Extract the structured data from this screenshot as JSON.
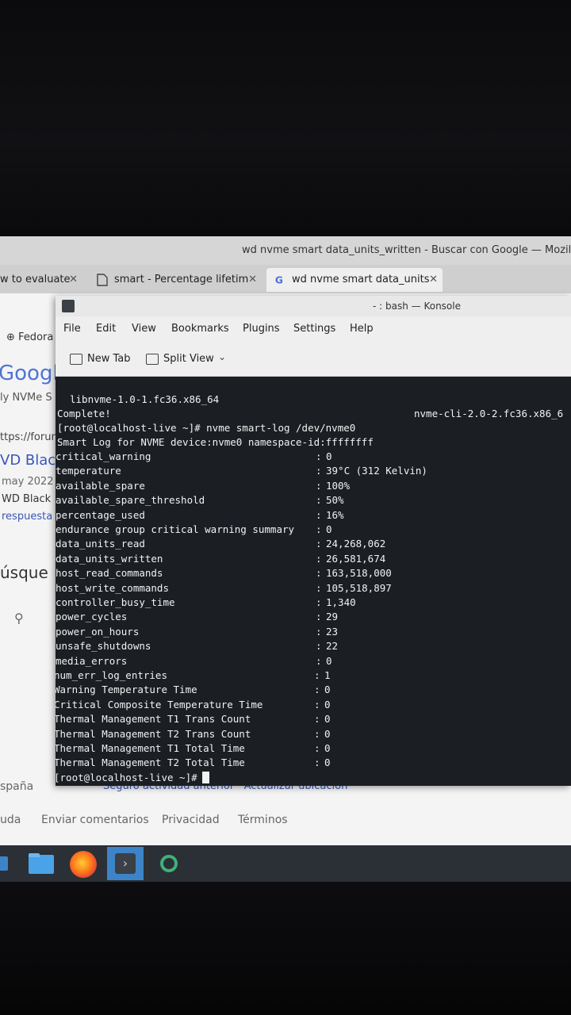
{
  "firefox": {
    "window_title": "wd nvme smart data_units_written - Buscar con Google — Mozilla Fire",
    "tabs": [
      {
        "label": "w to evaluate"
      },
      {
        "label": "smart - Percentage lifetim"
      },
      {
        "label": "wd nvme smart data_units"
      }
    ],
    "page_fragments": {
      "fedora": "Fedora",
      "google": "Google",
      "nvme": "ly NVMe S",
      "url": "ttps://forum",
      "wd_black": "VD Black",
      "date": "may 2022",
      "wd_black2": "WD Black",
      "respuesta": "respuesta",
      "busque": "úsque",
      "espana": "spaña",
      "location_line": "Seguro actividad anterior · Actualizar ubicación",
      "footer_links": [
        "uda",
        "Enviar comentarios",
        "Privacidad",
        "Términos"
      ]
    }
  },
  "konsole": {
    "title": "- : bash — Konsole",
    "menu": [
      "File",
      "Edit",
      "View",
      "Bookmarks",
      "Plugins",
      "Settings",
      "Help"
    ],
    "toolbar": {
      "new_tab": "New Tab",
      "split_view": "Split View"
    },
    "terminal": {
      "pkg_left": "libnvme-1.0-1.fc36.x86_64",
      "pkg_right": "nvme-cli-2.0-2.fc36.x86_6",
      "complete": "Complete!",
      "command": "[root@localhost-live ~]# nvme smart-log /dev/nvme0",
      "header": "Smart Log for NVME device:nvme0 namespace-id:ffffffff",
      "fields": [
        {
          "key": "critical_warning",
          "value": "0"
        },
        {
          "key": "temperature",
          "value": "39°C (312 Kelvin)"
        },
        {
          "key": "available_spare",
          "value": "100%"
        },
        {
          "key": "available_spare_threshold",
          "value": "50%"
        },
        {
          "key": "percentage_used",
          "value": "16%"
        },
        {
          "key": "endurance group critical warning summary",
          "value": "0"
        },
        {
          "key": "data_units_read",
          "value": "24,268,062"
        },
        {
          "key": "data_units_written",
          "value": "26,581,674"
        },
        {
          "key": "host_read_commands",
          "value": "163,518,000"
        },
        {
          "key": "host_write_commands",
          "value": "105,518,897"
        },
        {
          "key": "controller_busy_time",
          "value": "1,340"
        },
        {
          "key": "power_cycles",
          "value": "29"
        },
        {
          "key": "power_on_hours",
          "value": "23"
        },
        {
          "key": "unsafe_shutdowns",
          "value": "22"
        },
        {
          "key": "media_errors",
          "value": "0"
        },
        {
          "key": "num_err_log_entries",
          "value": "1"
        },
        {
          "key": "Warning Temperature Time",
          "value": "0"
        },
        {
          "key": "Critical Composite Temperature Time",
          "value": "0"
        },
        {
          "key": "Thermal Management T1 Trans Count",
          "value": "0"
        },
        {
          "key": "Thermal Management T2 Trans Count",
          "value": "0"
        },
        {
          "key": "Thermal Management T1 Total Time",
          "value": "0"
        },
        {
          "key": "Thermal Management T2 Total Time",
          "value": "0"
        }
      ],
      "prompt": "[root@localhost-live ~]#"
    }
  },
  "taskbar": {
    "items": [
      "launcher-icon",
      "files-icon",
      "firefox-icon",
      "konsole-icon",
      "app-icon"
    ]
  }
}
